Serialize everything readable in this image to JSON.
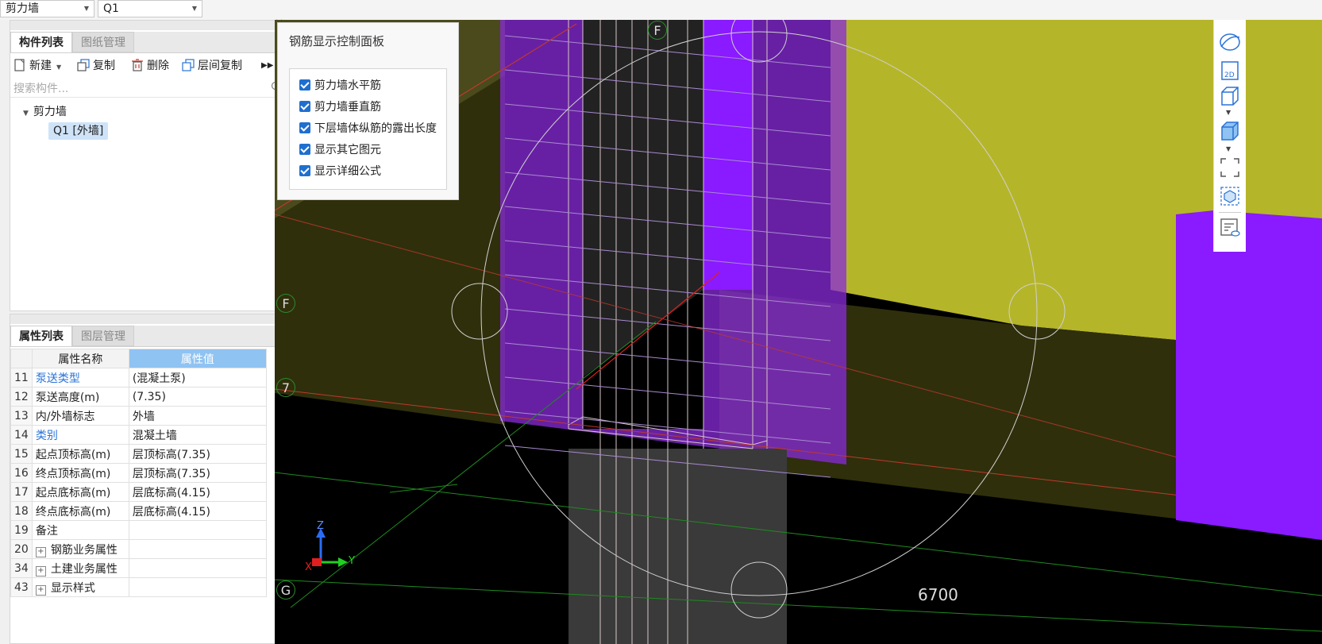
{
  "top_selectors": {
    "type_value": "剪力墙",
    "name_value": "Q1"
  },
  "component_panel": {
    "tabs": [
      "构件列表",
      "图纸管理"
    ],
    "toolbar": {
      "new_label": "新建",
      "copy_label": "复制",
      "delete_label": "删除",
      "floor_copy_label": "层间复制"
    },
    "search_placeholder": "搜索构件...",
    "tree": {
      "root_label": "剪力墙",
      "child_label": "Q1 [外墙]"
    }
  },
  "property_panel": {
    "tabs": [
      "属性列表",
      "图层管理"
    ],
    "header": {
      "name_col": "属性名称",
      "value_col": "属性值"
    },
    "rows": [
      {
        "num": "11",
        "name": "泵送类型",
        "value": "(混凝土泵)",
        "link": true,
        "expand": false
      },
      {
        "num": "12",
        "name": "泵送高度(m)",
        "value": "(7.35)",
        "link": false,
        "expand": false
      },
      {
        "num": "13",
        "name": "内/外墙标志",
        "value": "外墙",
        "link": false,
        "expand": false
      },
      {
        "num": "14",
        "name": "类别",
        "value": "混凝土墙",
        "link": true,
        "expand": false
      },
      {
        "num": "15",
        "name": "起点顶标高(m)",
        "value": "层顶标高(7.35)",
        "link": false,
        "expand": false
      },
      {
        "num": "16",
        "name": "终点顶标高(m)",
        "value": "层顶标高(7.35)",
        "link": false,
        "expand": false
      },
      {
        "num": "17",
        "name": "起点底标高(m)",
        "value": "层底标高(4.15)",
        "link": false,
        "expand": false
      },
      {
        "num": "18",
        "name": "终点底标高(m)",
        "value": "层底标高(4.15)",
        "link": false,
        "expand": false
      },
      {
        "num": "19",
        "name": "备注",
        "value": "",
        "link": false,
        "expand": false
      },
      {
        "num": "20",
        "name": "钢筋业务属性",
        "value": "",
        "link": false,
        "expand": true
      },
      {
        "num": "34",
        "name": "土建业务属性",
        "value": "",
        "link": false,
        "expand": true
      },
      {
        "num": "43",
        "name": "显示样式",
        "value": "",
        "link": false,
        "expand": true
      }
    ]
  },
  "rebar_control_panel": {
    "title": "钢筋显示控制面板",
    "options": [
      {
        "label": "剪力墙水平筋",
        "checked": true
      },
      {
        "label": "剪力墙垂直筋",
        "checked": true
      },
      {
        "label": "下层墙体纵筋的露出长度",
        "checked": true
      },
      {
        "label": "显示其它图元",
        "checked": true
      },
      {
        "label": "显示详细公式",
        "checked": true
      }
    ]
  },
  "viewport": {
    "grid_labels": {
      "top": "F",
      "left_f": "F",
      "left_7": "7",
      "left_g": "G"
    },
    "axes": {
      "x": "X",
      "y": "Y",
      "z": "Z"
    },
    "dimension": "6700",
    "right_toolbar": {
      "icons": [
        "orbit-icon",
        "view-2d-icon",
        "view-3d-box-icon",
        "view-3d-shaded-icon",
        "fullscreen-icon",
        "component-select-icon",
        "display-settings-icon"
      ],
      "view_2d_label": "2D"
    },
    "colors": {
      "background": "#000000",
      "wall_yellow": "#b5b52a",
      "wall_purple": "#8a1aff",
      "slab_olive": "#3b3a10",
      "grid_green": "#1f8a1f",
      "axis_red": "#c0392b"
    }
  }
}
